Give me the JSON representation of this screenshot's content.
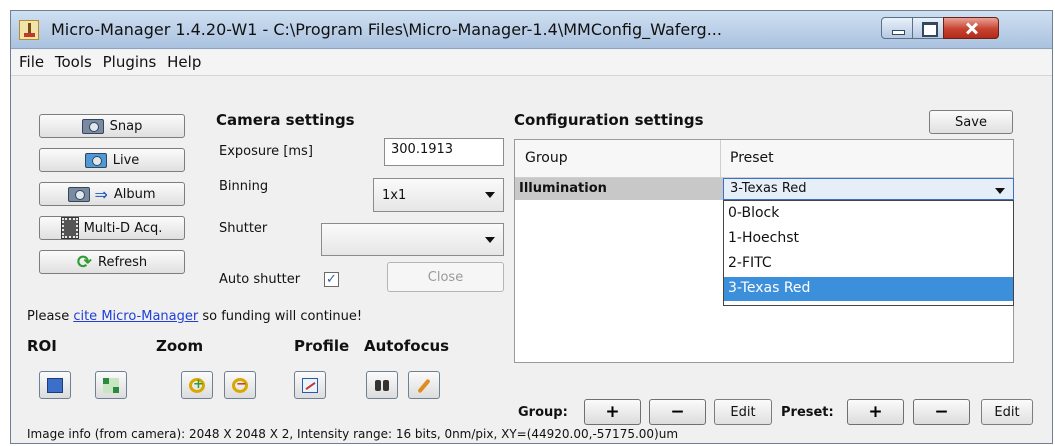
{
  "window": {
    "title": "Micro-Manager 1.4.20-W1 - C:\\Program Files\\Micro-Manager-1.4\\MMConfig_Waferg...",
    "controls": [
      "minimize-icon",
      "maximize-icon",
      "close-icon"
    ]
  },
  "menu": [
    "File",
    "Tools",
    "Plugins",
    "Help"
  ],
  "left_buttons": {
    "snap": "Snap",
    "live": "Live",
    "album": "Album",
    "multid": "Multi-D Acq.",
    "refresh": "Refresh"
  },
  "camera": {
    "title": "Camera settings",
    "exposure_label": "Exposure [ms]",
    "exposure_value": "300.1913",
    "binning_label": "Binning",
    "binning_value": "1x1",
    "shutter_label": "Shutter",
    "shutter_value": "",
    "auto_shutter_label": "Auto shutter",
    "auto_shutter_checked": "✓",
    "close_label": "Close"
  },
  "cite": {
    "prefix": "Please ",
    "link": "cite Micro-Manager",
    "suffix": " so funding will continue!"
  },
  "tools": {
    "roi": "ROI",
    "zoom": "Zoom",
    "profile": "Profile",
    "autofocus": "Autofocus"
  },
  "config": {
    "title": "Configuration settings",
    "save": "Save",
    "col_group": "Group",
    "col_preset": "Preset",
    "row_group": "Illumination",
    "row_preset": "3-Texas Red",
    "options": [
      "0-Block",
      "1-Hoechst",
      "2-FITC",
      "3-Texas Red"
    ],
    "selected_index": 3
  },
  "bottom": {
    "group_label": "Group:",
    "preset_label": "Preset:",
    "plus": "+",
    "minus": "−",
    "edit": "Edit"
  },
  "status": "Image info (from camera): 2048 X 2048 X 2, Intensity range: 16 bits, 0nm/pix, XY=(44920.00,-57175.00)um"
}
